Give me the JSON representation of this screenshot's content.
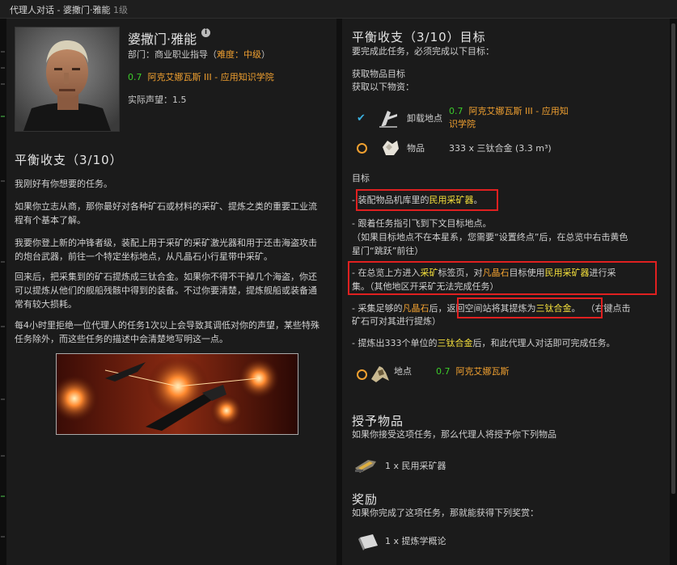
{
  "window": {
    "title": "代理人对话 - 婆撒门·雅能",
    "level": "1级"
  },
  "agent": {
    "name": "婆撒门·雅能",
    "division_prefix": "部门：商业职业指导（",
    "difficulty": "难度：中级",
    "division_suffix": "）",
    "security": "0.7",
    "location": "阿克艾娜瓦斯 III - 应用知识学院",
    "standing_label": "实际声望：1.5"
  },
  "mission": {
    "title": "平衡收支（3/10）",
    "paragraphs": [
      "我刚好有你想要的任务。",
      "如果你立志从商，那你最好对各种矿石或材料的采矿、提炼之类的重要工业流程有个基本了解。",
      "我要你登上新的冲锋者级，装配上用于采矿的采矿激光器和用于还击海盗攻击的炮台武器，前往一个特定坐标地点，从凡晶石小行星带中采矿。",
      "回来后，把采集到的矿石提炼成三钛合金。如果你不得不干掉几个海盗，你还可以提炼从他们的舰船残骸中得到的装备。不过你要清楚，提炼舰船或装备通常有较大损耗。",
      "每4小时里拒绝一位代理人的任务1次以上会导致其调低对你的声望，某些特殊任务除外，而这些任务的描述中会清楚地写明这一点。"
    ]
  },
  "objectives": {
    "header": "平衡收支（3/10）目标",
    "intro": "要完成此任务，必须完成以下目标：",
    "fetch_title": "获取物品目标",
    "fetch_sub": "获取以下物资：",
    "rows": [
      {
        "icon": "checkmark-icon",
        "label": "卸载地点",
        "security": "0.7",
        "value": "阿克艾娜瓦斯 III - 应用知识学院"
      },
      {
        "icon": "circle-icon",
        "label": "物品",
        "value": "333 x 三钛合金 (3.3 m³)"
      }
    ],
    "target_label": "目标",
    "steps": {
      "s1_prefix": "- 装配物品机库里的",
      "s1_hl": "民用采矿器",
      "s1_suffix": "。",
      "s2_line1": "- 跟着任务指引飞到下文目标地点。",
      "s2_line2": "（如果目标地点不在本星系，您需要“设置终点”后，在总览中右击黄色",
      "s2_line3": "星门“跳跃”前往）",
      "s3_a": "- 在总览上方进入",
      "s3_b": "采矿",
      "s3_c": "标签页，对",
      "s3_d": "凡晶石",
      "s3_e": "目标使用",
      "s3_f": "民用采矿器",
      "s3_g": "进行采",
      "s3_line2": "集。（其他地区开采矿无法完成任务）",
      "s4_a": "- 采集足够的",
      "s4_b": "凡晶石",
      "s4_c": "后，",
      "s4_d": "返回空间站将其提炼为",
      "s4_e": "三钛合金",
      "s4_f": "。",
      "s4_g": "（右键点击",
      "s4_line2": "矿石可对其进行提炼）",
      "s5_a": "- 提炼出333个单位的",
      "s5_b": "三钛合金",
      "s5_c": "后，和此代理人对话即可完成任务。"
    },
    "location_row": {
      "label": "地点",
      "security": "0.7",
      "value": "阿克艾娜瓦斯"
    }
  },
  "granted": {
    "header": "授予物品",
    "desc": "如果你接受这项任务，那么代理人将授予你下列物品",
    "item": "1 x 民用采矿器"
  },
  "reward": {
    "header": "奖励",
    "desc": "如果你完成了这项任务，那就能获得下列奖赏：",
    "item": "1 x 提炼学概论"
  },
  "colors": {
    "accent_orange": "#f0a030",
    "security_green": "#3ccc2a",
    "highlight_yellow": "#f5e03c",
    "annotation_red": "#e02020"
  }
}
